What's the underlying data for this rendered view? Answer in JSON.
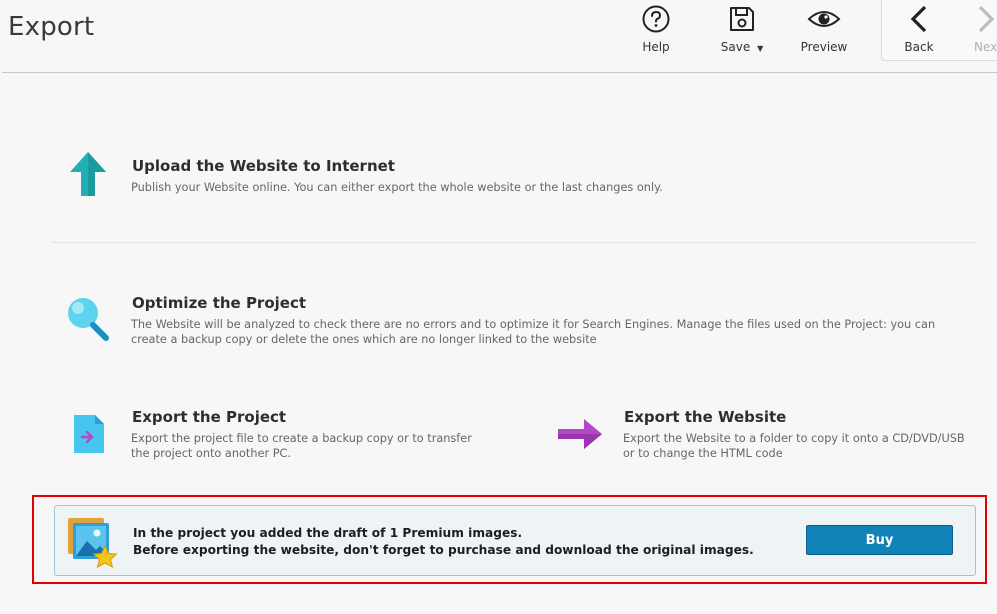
{
  "header": {
    "title": "Export",
    "tools": {
      "help": "Help",
      "save": "Save",
      "preview": "Preview",
      "back": "Back",
      "next": "Nex"
    }
  },
  "options": {
    "upload": {
      "title": "Upload the Website to Internet",
      "desc": "Publish your Website online. You can either export the whole website or the last changes only."
    },
    "optimize": {
      "title": "Optimize the Project",
      "desc": "The Website will be analyzed to check there are no errors and to optimize it for Search Engines. Manage the files used on the Project: you can create a backup copy or delete the ones which are no longer linked to the website"
    },
    "export_project": {
      "title": "Export the Project",
      "desc": "Export the project file to create a backup copy or to transfer the project onto another PC."
    },
    "export_website": {
      "title": "Export the Website",
      "desc": "Export the Website to a folder to copy it onto a CD/DVD/USB or to change the HTML code"
    }
  },
  "notice": {
    "line1": "In the project you added the draft of 1 Premium images.",
    "line2": "Before exporting the website, don't forget to purchase and download the original images.",
    "buy_label": "Buy"
  },
  "colors": {
    "accent": "#1183b9",
    "highlight_border": "#e00000",
    "teal_icon": "#22aeb4",
    "purple_icon": "#b547c9"
  }
}
